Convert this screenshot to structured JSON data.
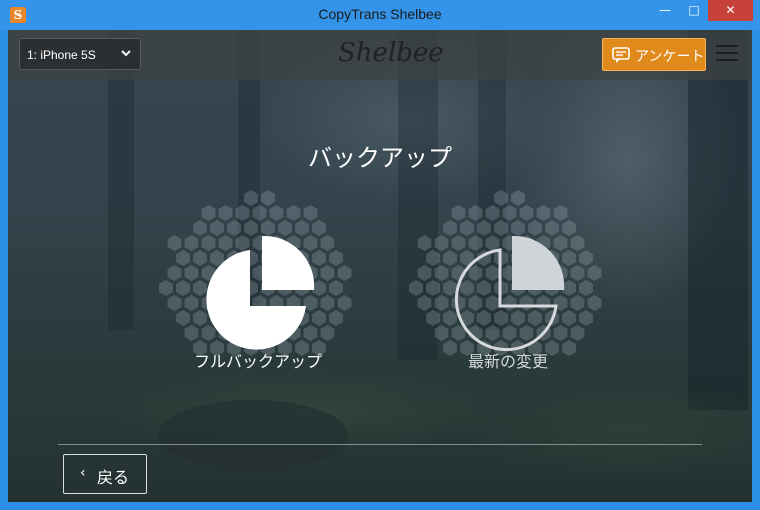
{
  "window": {
    "title": "CopyTrans Shelbee",
    "app_icon": "S"
  },
  "header": {
    "device_selected": "1: iPhone 5S",
    "logo": "Shelbee",
    "survey_label": "アンケート",
    "accent": "#e08a1c"
  },
  "main": {
    "heading": "バックアップ",
    "options": [
      {
        "label": "フルバックアップ",
        "icon": "pie-chart-filled-icon"
      },
      {
        "label": "最新の変更",
        "icon": "pie-chart-outline-icon"
      }
    ]
  },
  "footer": {
    "back_label": "戻る"
  }
}
